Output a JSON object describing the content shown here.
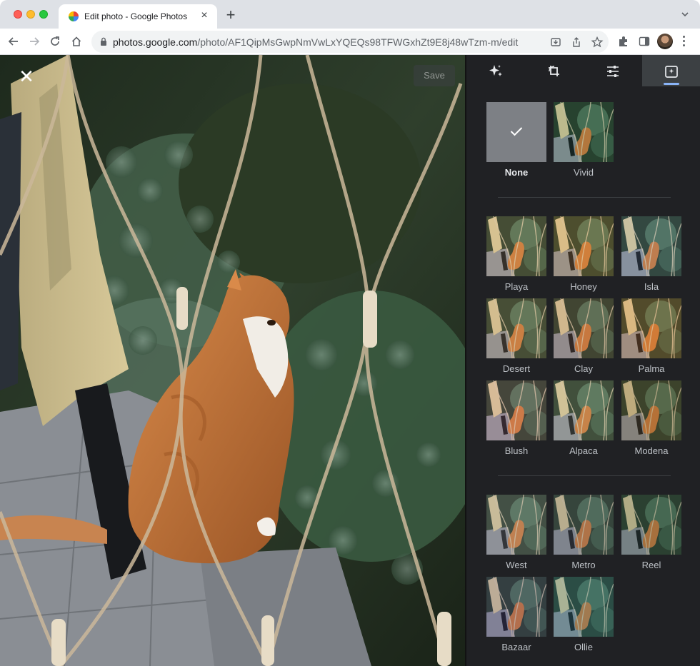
{
  "browser": {
    "tab_title": "Edit photo - Google Photos",
    "url_host": "photos.google.com",
    "url_path": "/photo/AF1QipMsGwpNmVwLxYQEQs98TFWGxhZt9E8j48wTzm-m/edit"
  },
  "editor": {
    "save_label": "Save",
    "close_icon": "close-icon",
    "tabs": [
      {
        "name": "suggestions",
        "icon": "sparkle-icon"
      },
      {
        "name": "crop",
        "icon": "crop-rotate-icon"
      },
      {
        "name": "adjust",
        "icon": "sliders-icon"
      },
      {
        "name": "filters",
        "icon": "filters-icon",
        "active": true
      }
    ]
  },
  "filters": {
    "selected": "None",
    "group1": [
      "None",
      "Vivid"
    ],
    "group2": [
      "Playa",
      "Honey",
      "Isla",
      "Desert",
      "Clay",
      "Palma",
      "Blush",
      "Alpaca",
      "Modena"
    ],
    "group3": [
      "West",
      "Metro",
      "Reel",
      "Bazaar",
      "Ollie"
    ]
  },
  "colors": {
    "panel_bg": "#202124",
    "active_tab": "#3c4043",
    "accent": "#8ab4f8"
  }
}
